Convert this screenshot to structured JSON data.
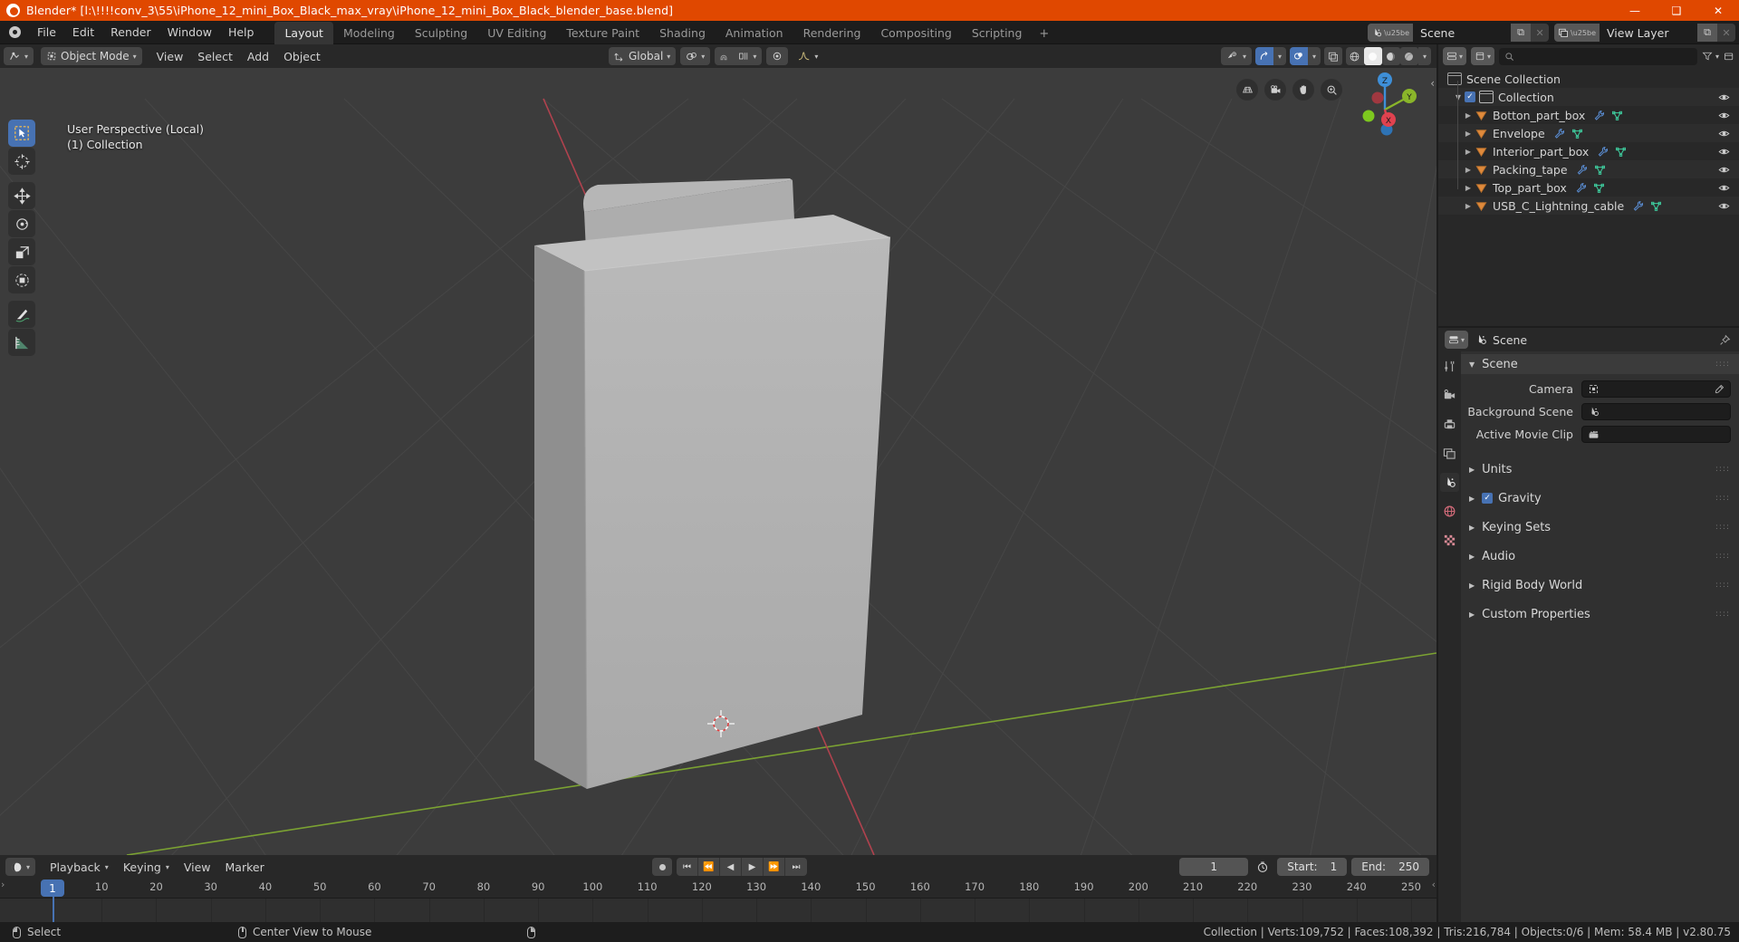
{
  "window": {
    "title": "Blender* [l:\\!!!!conv_3\\55\\iPhone_12_mini_Box_Black_max_vray\\iPhone_12_mini_Box_Black_blender_base.blend]",
    "minimize": "—",
    "maximize": "❑",
    "close": "✕"
  },
  "topbar": {
    "menus": [
      "File",
      "Edit",
      "Render",
      "Window",
      "Help"
    ],
    "tabs": [
      "Layout",
      "Modeling",
      "Sculpting",
      "UV Editing",
      "Texture Paint",
      "Shading",
      "Animation",
      "Rendering",
      "Compositing",
      "Scripting"
    ],
    "active_tab": "Layout",
    "add_tab": "+",
    "scene_name": "Scene",
    "view_layer_name": "View Layer",
    "copy_glyph": "⧉",
    "close_glyph": "✕"
  },
  "viewport": {
    "mode": "Object Mode",
    "menus": [
      "View",
      "Select",
      "Add",
      "Object"
    ],
    "transform_orientation": "Global",
    "overlay_line1": "User Perspective (Local)",
    "overlay_line2": "(1) Collection",
    "gizmo_axes": {
      "x": "X",
      "y": "Y",
      "z": "Z"
    },
    "nav_buttons": [
      "grid-icon",
      "camera-icon",
      "hand-icon",
      "zoom-icon"
    ],
    "tools": [
      "select-box-tool",
      "cursor-tool",
      "move-tool",
      "rotate-tool",
      "scale-tool",
      "transform-tool",
      "annotate-tool",
      "measure-tool"
    ],
    "shading_modes": [
      "wireframe",
      "solid",
      "material-preview",
      "rendered"
    ],
    "active_shading": "solid",
    "colors": {
      "background": "#3c3c3c",
      "grid": "#4a4a4a",
      "axis_x": "#cc4452",
      "axis_y": "#8ab52a",
      "box_front": "#b1b1b1",
      "box_side": "#9a9a9a",
      "box_top": "#c3c3c3"
    }
  },
  "outliner": {
    "search_placeholder": "",
    "root": "Scene Collection",
    "items": [
      {
        "label": "Collection",
        "type": "collection",
        "depth": 1,
        "checked": true,
        "expanded": true,
        "visible": true
      },
      {
        "label": "Botton_part_box",
        "type": "mesh",
        "depth": 2,
        "visible": true
      },
      {
        "label": "Envelope",
        "type": "mesh",
        "depth": 2,
        "visible": true
      },
      {
        "label": "Interior_part_box",
        "type": "mesh",
        "depth": 2,
        "visible": true
      },
      {
        "label": "Packing_tape",
        "type": "mesh",
        "depth": 2,
        "visible": true
      },
      {
        "label": "Top_part_box",
        "type": "mesh",
        "depth": 2,
        "visible": true
      },
      {
        "label": "USB_C_Lightning_cable",
        "type": "mesh",
        "depth": 2,
        "visible": true
      }
    ]
  },
  "properties": {
    "breadcrumb": "Scene",
    "tabs": [
      "tool",
      "render",
      "output",
      "view-layer",
      "scene",
      "world",
      "texture"
    ],
    "active_tab": "scene",
    "scene_panel_title": "Scene",
    "fields": [
      {
        "label": "Camera",
        "value": "",
        "icon": "camera-object-icon"
      },
      {
        "label": "Background Scene",
        "value": "",
        "icon": "scene-icon"
      },
      {
        "label": "Active Movie Clip",
        "value": "",
        "icon": "clip-icon"
      }
    ],
    "panels": [
      {
        "label": "Units",
        "checkbox": false
      },
      {
        "label": "Gravity",
        "checkbox": true
      },
      {
        "label": "Keying Sets",
        "checkbox": false
      },
      {
        "label": "Audio",
        "checkbox": false
      },
      {
        "label": "Rigid Body World",
        "checkbox": false
      },
      {
        "label": "Custom Properties",
        "checkbox": false
      }
    ]
  },
  "timeline": {
    "menus": [
      "Playback",
      "Keying",
      "View",
      "Marker"
    ],
    "current_frame": "1",
    "start_label": "Start:",
    "start_value": "1",
    "end_label": "End:",
    "end_value": "250",
    "ticks": [
      {
        "label": "1",
        "frame": 1
      },
      {
        "label": "10",
        "frame": 10
      },
      {
        "label": "20",
        "frame": 20
      },
      {
        "label": "30",
        "frame": 30
      },
      {
        "label": "40",
        "frame": 40
      },
      {
        "label": "50",
        "frame": 50
      },
      {
        "label": "60",
        "frame": 60
      },
      {
        "label": "70",
        "frame": 70
      },
      {
        "label": "80",
        "frame": 80
      },
      {
        "label": "90",
        "frame": 90
      },
      {
        "label": "100",
        "frame": 100
      },
      {
        "label": "110",
        "frame": 110
      },
      {
        "label": "120",
        "frame": 120
      },
      {
        "label": "130",
        "frame": 130
      },
      {
        "label": "140",
        "frame": 140
      },
      {
        "label": "150",
        "frame": 150
      },
      {
        "label": "160",
        "frame": 160
      },
      {
        "label": "170",
        "frame": 170
      },
      {
        "label": "180",
        "frame": 180
      },
      {
        "label": "190",
        "frame": 190
      },
      {
        "label": "200",
        "frame": 200
      },
      {
        "label": "210",
        "frame": 210
      },
      {
        "label": "220",
        "frame": 220
      },
      {
        "label": "230",
        "frame": 230
      },
      {
        "label": "240",
        "frame": 240
      },
      {
        "label": "250",
        "frame": 250
      }
    ]
  },
  "statusbar": {
    "left_action": "Select",
    "mid_action": "Center View to Mouse",
    "stats": "Collection | Verts:109,752 | Faces:108,392 | Tris:216,784 | Objects:0/6 | Mem: 58.4 MB | v2.80.75"
  }
}
